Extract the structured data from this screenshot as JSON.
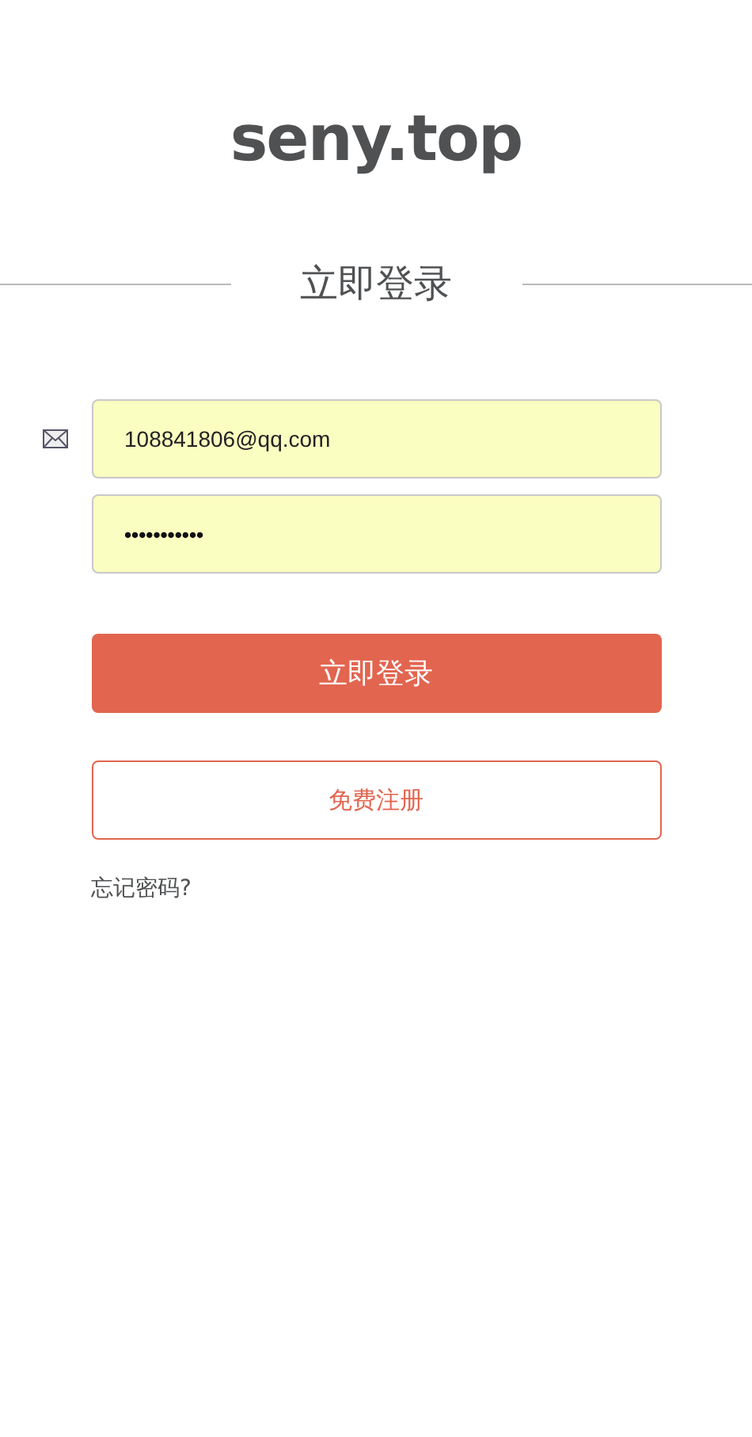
{
  "site_title": "seny.top",
  "heading": "立即登录",
  "email_field": {
    "value": "108841806@qq.com"
  },
  "password_field": {
    "value": "•••••••••••"
  },
  "login_button": "立即登录",
  "register_button": "免费注册",
  "forgot_link": "忘记密码?"
}
